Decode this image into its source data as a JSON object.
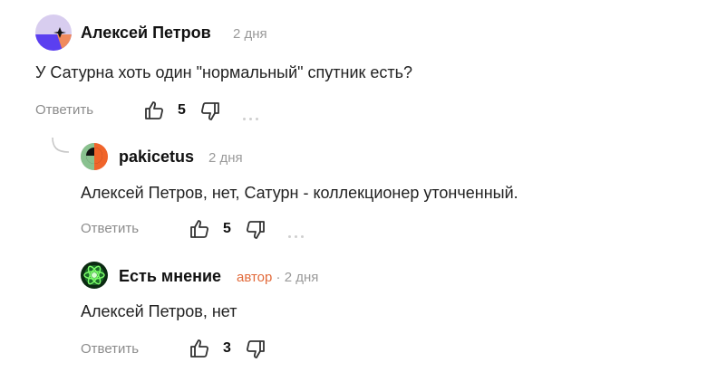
{
  "comments": [
    {
      "author": "Алексей Петров",
      "time": "2 дня",
      "text": "У Сатурна хоть один \"нормальный\" спутник есть?",
      "reply_label": "Ответить",
      "likes": "5"
    },
    {
      "author": "pakicetus",
      "time": "2 дня",
      "text": "Алексей Петров, нет, Сатурн - коллекционер утонченный.",
      "reply_label": "Ответить",
      "likes": "5"
    },
    {
      "author": "Есть мнение",
      "badge": "автор",
      "time": "· 2 дня",
      "text": "Алексей Петров, нет",
      "reply_label": "Ответить",
      "likes": "3"
    }
  ],
  "icons": {
    "like": "thumb-up-icon",
    "dislike": "thumb-down-icon",
    "more": "more-dots-icon",
    "thread": "reply-thread-icon"
  },
  "colors": {
    "badge": "#e26a3a",
    "meta": "#9a9a9a",
    "reply": "#8c8c8c"
  }
}
